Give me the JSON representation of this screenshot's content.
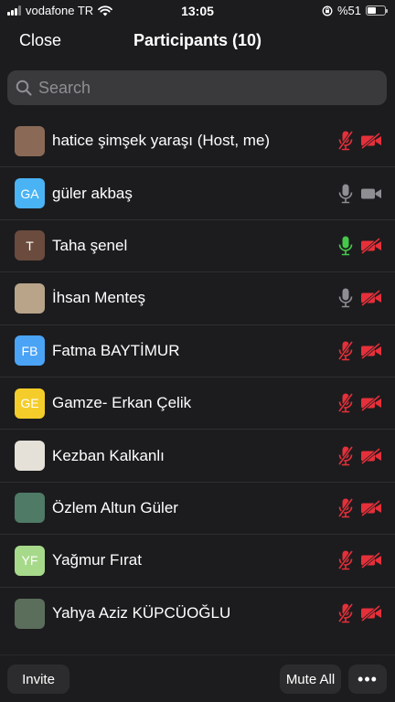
{
  "status_bar": {
    "carrier": "vodafone TR",
    "time": "13:05",
    "battery_text": "%51",
    "battery_level": 0.51
  },
  "header": {
    "close_label": "Close",
    "title": "Participants (10)"
  },
  "search": {
    "placeholder": "Search"
  },
  "participants": [
    {
      "name": "hatice şimşek yaraşı (Host, me)",
      "avatar_text": "",
      "avatar_color": "#8a6a56",
      "mic": "muted",
      "camera": "off"
    },
    {
      "name": "güler akbaş",
      "avatar_text": "GA",
      "avatar_color": "#4ab3f4",
      "mic": "on",
      "camera": "on"
    },
    {
      "name": "Taha şenel",
      "avatar_text": "T",
      "avatar_color": "#6b4b3d",
      "mic": "active",
      "camera": "off"
    },
    {
      "name": "İhsan Menteş",
      "avatar_text": "",
      "avatar_color": "#b9a48a",
      "mic": "on",
      "camera": "off"
    },
    {
      "name": "Fatma BAYTİMUR",
      "avatar_text": "FB",
      "avatar_color": "#4aa3f5",
      "mic": "muted",
      "camera": "off"
    },
    {
      "name": "Gamze- Erkan Çelik",
      "avatar_text": "GE",
      "avatar_color": "#f5cd2a",
      "mic": "muted",
      "camera": "off"
    },
    {
      "name": "Kezban Kalkanlı",
      "avatar_text": "",
      "avatar_color": "#e5e0d8",
      "mic": "muted",
      "camera": "off"
    },
    {
      "name": "Özlem Altun Güler",
      "avatar_text": "",
      "avatar_color": "#4e7a66",
      "mic": "muted",
      "camera": "off"
    },
    {
      "name": "Yağmur Fırat",
      "avatar_text": "YF",
      "avatar_color": "#a7d98b",
      "mic": "muted",
      "camera": "off"
    },
    {
      "name": "Yahya Aziz KÜPCÜOĞLU",
      "avatar_text": "",
      "avatar_color": "#5b6e5c",
      "mic": "muted",
      "camera": "off"
    }
  ],
  "footer": {
    "invite_label": "Invite",
    "mute_all_label": "Mute All",
    "more_label": "•••"
  },
  "colors": {
    "muted_red": "#e5303a",
    "active_green": "#46c84a",
    "neutral_gray": "#8e8e93"
  }
}
